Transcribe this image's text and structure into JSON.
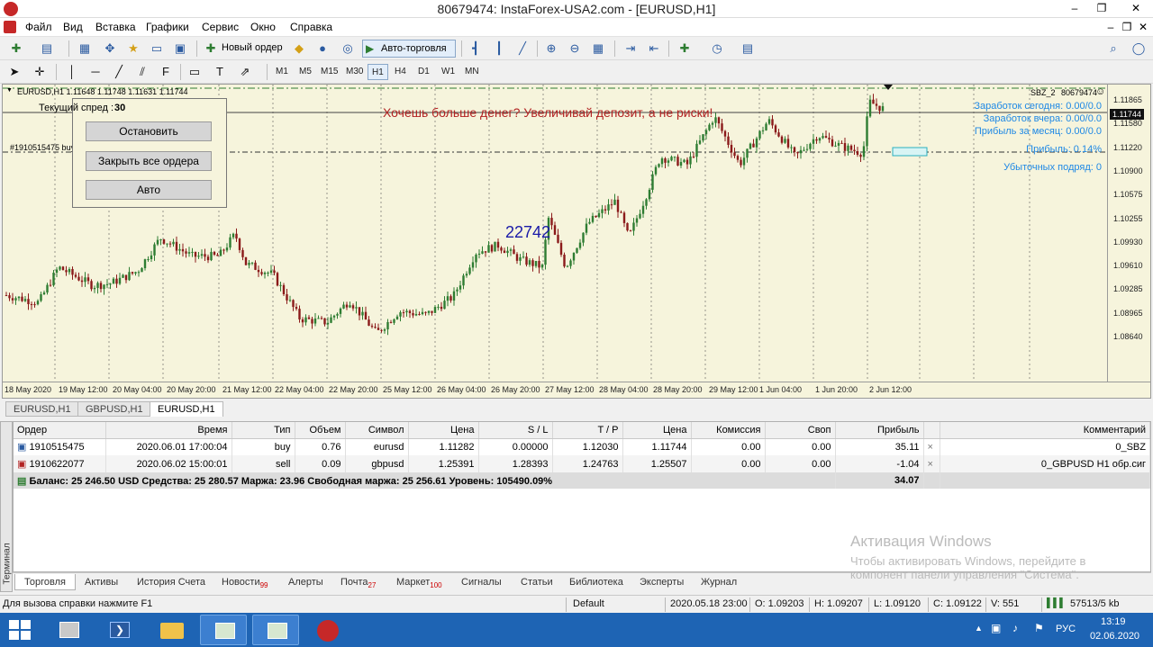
{
  "window": {
    "title": "80679474: InstaForex-USA2.com - [EURUSD,H1]"
  },
  "menu": [
    "Файл",
    "Вид",
    "Вставка",
    "Графики",
    "Сервис",
    "Окно",
    "Справка"
  ],
  "toolbar": {
    "new_order": "Новый ордер",
    "auto_trading": "Авто-торговля"
  },
  "timeframes": [
    "M1",
    "M5",
    "M15",
    "M30",
    "H1",
    "H4",
    "D1",
    "W1",
    "MN"
  ],
  "chart": {
    "header": "EURUSD,H1  1.11648 1.11748 1.11631 1.11744",
    "spread_label": "Текущий спред :",
    "spread_value": "30",
    "order_line_label": "#1910515475 buy",
    "banner": "Хочешь больше денег? Увеличивай депозит, а не риски!",
    "price_label": "22742",
    "expert_name": "SBZ_2",
    "account_no": "80679474",
    "stats": [
      "Заработок сегодня: 0.00/0.0",
      "Заработок вчера: 0.00/0.0",
      "Прибыль за месяц: 0.00/0.0",
      "Прибыль: 0.14%",
      "Убыточных подряд: 0"
    ],
    "y_ticks": [
      "1.11865",
      "1.11580",
      "1.11220",
      "1.10900",
      "1.10575",
      "1.10255",
      "1.09930",
      "1.09610",
      "1.09285",
      "1.08965",
      "1.08640"
    ],
    "current_price": "1.11744",
    "x_ticks": [
      "18 May 2020",
      "19 May 12:00",
      "20 May 04:00",
      "20 May 20:00",
      "21 May 12:00",
      "22 May 04:00",
      "22 May 20:00",
      "25 May 12:00",
      "26 May 04:00",
      "26 May 20:00",
      "27 May 12:00",
      "28 May 04:00",
      "28 May 20:00",
      "29 May 12:00",
      "1 Jun 04:00",
      "1 Jun 20:00",
      "2 Jun 12:00"
    ],
    "colors": {
      "background": "#f6f4dc",
      "bull": "#2e7d32",
      "bear": "#8b1a1a",
      "grid": "#555555",
      "stats": "#1e88e5",
      "banner": "#b22222"
    }
  },
  "panel": {
    "stop": "Остановить",
    "close_all": "Закрыть все ордера",
    "auto": "Авто"
  },
  "chart_tabs": [
    "EURUSD,H1",
    "GBPUSD,H1",
    "EURUSD,H1"
  ],
  "terminal": {
    "headers": [
      "Ордер",
      "Время",
      "Тип",
      "Объем",
      "Символ",
      "Цена",
      "S / L",
      "T / P",
      "Цена",
      "Комиссия",
      "Своп",
      "Прибыль",
      "",
      "Комментарий"
    ],
    "rows": [
      [
        "1910515475",
        "2020.06.01 17:00:04",
        "buy",
        "0.76",
        "eurusd",
        "1.11282",
        "0.00000",
        "1.12030",
        "1.11744",
        "0.00",
        "0.00",
        "35.11",
        "×",
        "0_SBZ"
      ],
      [
        "1910622077",
        "2020.06.02 15:00:01",
        "sell",
        "0.09",
        "gbpusd",
        "1.25391",
        "1.28393",
        "1.24763",
        "1.25507",
        "0.00",
        "0.00",
        "-1.04",
        "×",
        "0_GBPUSD H1 обр.сиг"
      ]
    ],
    "balance": "Баланс: 25 246.50 USD  Средства: 25 280.57  Маржа: 23.96  Свободная маржа: 25 256.61  Уровень: 105490.09%",
    "balance_profit": "34.07",
    "side_label": "Терминал"
  },
  "terminal_tabs": [
    {
      "label": "Торговля"
    },
    {
      "label": "Активы"
    },
    {
      "label": "История Счета"
    },
    {
      "label": "Новости",
      "badge": "99"
    },
    {
      "label": "Алерты"
    },
    {
      "label": "Почта",
      "badge": "27"
    },
    {
      "label": "Маркет",
      "badge": "100"
    },
    {
      "label": "Сигналы"
    },
    {
      "label": "Статьи"
    },
    {
      "label": "Библиотека"
    },
    {
      "label": "Эксперты"
    },
    {
      "label": "Журнал"
    }
  ],
  "status": {
    "help": "Для вызова справки нажмите F1",
    "profile": "Default",
    "datetime": "2020.05.18 23:00",
    "open": "O: 1.09203",
    "high": "H: 1.09207",
    "low": "L: 1.09120",
    "close": "C: 1.09122",
    "volume": "V: 551",
    "traffic": "57513/5 kb"
  },
  "watermark": {
    "title": "Активация Windows",
    "line1": "Чтобы активировать Windows, перейдите в",
    "line2": "компонент панели управления \"Система\"."
  },
  "taskbar": {
    "lang": "РУС",
    "time": "13:19",
    "date": "02.06.2020"
  }
}
